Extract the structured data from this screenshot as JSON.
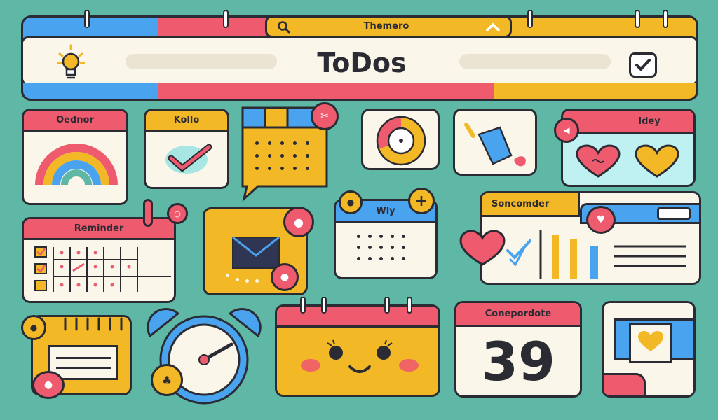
{
  "header": {
    "title": "ToDos",
    "search_label": "Themero"
  },
  "cards": {
    "organizer": "Oednor",
    "hello": "Kollo",
    "idea": "Idey",
    "reminder": "Reminder",
    "weekly": "Wly",
    "sonocrder": "Soncomder",
    "countdown": "Conepordote",
    "countdown_number": "39"
  },
  "colors": {
    "background": "#5fb7a6",
    "accent_yellow": "#f2b826",
    "accent_red": "#ef5b6e",
    "accent_blue": "#4aa3ee",
    "cream": "#fbf6ea",
    "ink": "#2b2b33"
  },
  "icons": [
    "lightbulb-icon",
    "search-icon",
    "chevron-up-icon",
    "checkbox-icon",
    "rainbow-icon",
    "checkmark-icon",
    "calendar-icon",
    "donut-chart-icon",
    "broom-icon",
    "heart-icon",
    "mail-icon",
    "alarm-clock-icon",
    "smiley-calendar-icon",
    "photo-icon",
    "bar-chart-icon"
  ]
}
